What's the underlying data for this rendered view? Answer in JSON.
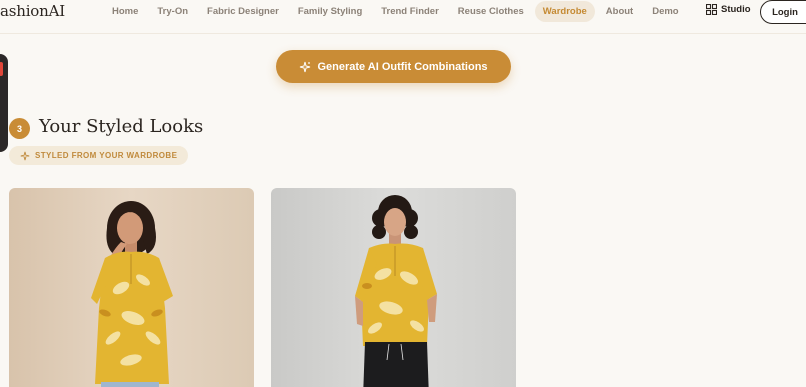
{
  "nav": {
    "logo": "ashionAI",
    "links": [
      {
        "label": "Home",
        "active": false
      },
      {
        "label": "Try-On",
        "active": false
      },
      {
        "label": "Fabric Designer",
        "active": false
      },
      {
        "label": "Family Styling",
        "active": false
      },
      {
        "label": "Trend Finder",
        "active": false
      },
      {
        "label": "Reuse Clothes",
        "active": false
      },
      {
        "label": "Wardrobe",
        "active": true
      },
      {
        "label": "About",
        "active": false
      },
      {
        "label": "Demo",
        "active": false
      }
    ],
    "studio_label": "Studio",
    "login_label": "Login"
  },
  "generate_button": {
    "label": "Generate AI Outfit Combinations",
    "icon": "sparkle-icon"
  },
  "section": {
    "step": "3",
    "title": "Your Styled Looks",
    "badge": "STYLED FROM YOUR WARDROBE"
  },
  "looks": [
    {
      "image": "woman-yellow-floral-tunic-jeans"
    },
    {
      "image": "woman-yellow-floral-tunic-black-pants"
    }
  ],
  "colors": {
    "accent": "#c98c36",
    "background": "#faf8f4",
    "text": "#2b2520",
    "muted": "#8c8278"
  }
}
